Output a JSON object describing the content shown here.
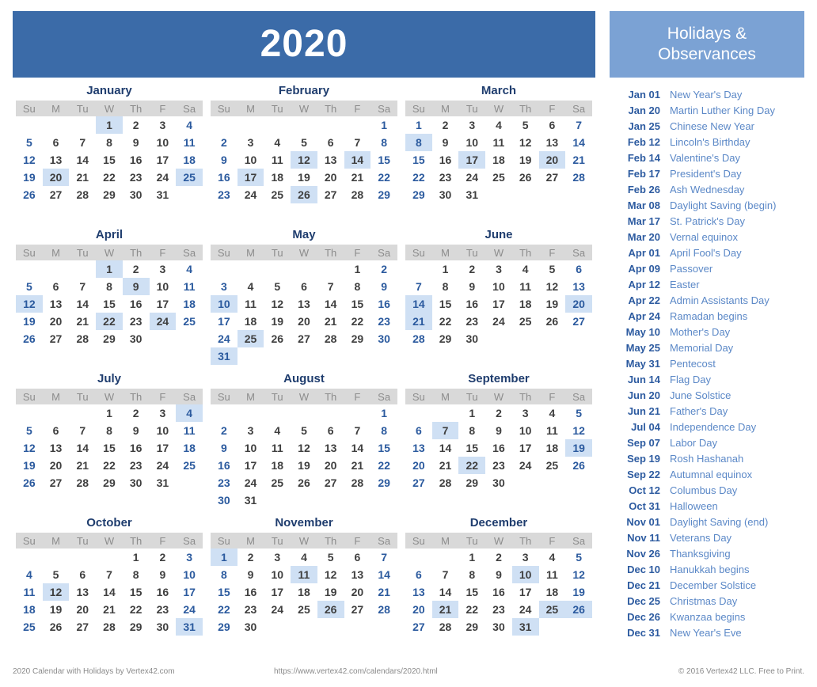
{
  "header": {
    "year": "2020"
  },
  "sidebar": {
    "title_line1": "Holidays &",
    "title_line2": "Observances"
  },
  "weekday_headers": [
    "Su",
    "M",
    "Tu",
    "W",
    "Th",
    "F",
    "Sa"
  ],
  "colors": {
    "banner_blue": "#3b6ba8",
    "sidebar_blue": "#7ba2d4",
    "highlight_blue": "#cfe0f4",
    "weekday_header_gray": "#d9d9d9",
    "weekend_text": "#2b5a9e",
    "weekday_text": "#3f3f3f",
    "month_title": "#1f3d6e",
    "holiday_date": "#2d5ba0",
    "holiday_name": "#5b88c7"
  },
  "months": [
    {
      "name": "January",
      "start": 3,
      "days": 31,
      "highlights": [
        1,
        20,
        25
      ]
    },
    {
      "name": "February",
      "start": 6,
      "days": 29,
      "highlights": [
        12,
        14,
        17,
        26
      ]
    },
    {
      "name": "March",
      "start": 0,
      "days": 31,
      "highlights": [
        8,
        17,
        20
      ]
    },
    {
      "name": "April",
      "start": 3,
      "days": 30,
      "highlights": [
        1,
        9,
        12,
        22,
        24
      ]
    },
    {
      "name": "May",
      "start": 5,
      "days": 31,
      "highlights": [
        10,
        25,
        31
      ]
    },
    {
      "name": "June",
      "start": 1,
      "days": 30,
      "highlights": [
        14,
        20,
        21
      ]
    },
    {
      "name": "July",
      "start": 3,
      "days": 31,
      "highlights": [
        4
      ]
    },
    {
      "name": "August",
      "start": 6,
      "days": 31,
      "highlights": []
    },
    {
      "name": "September",
      "start": 2,
      "days": 30,
      "highlights": [
        7,
        19,
        22
      ]
    },
    {
      "name": "October",
      "start": 4,
      "days": 31,
      "highlights": [
        12,
        31
      ]
    },
    {
      "name": "November",
      "start": 0,
      "days": 30,
      "highlights": [
        1,
        11,
        26
      ]
    },
    {
      "name": "December",
      "start": 2,
      "days": 31,
      "highlights": [
        10,
        21,
        25,
        26,
        31
      ]
    }
  ],
  "holidays": [
    {
      "date": "Jan 01",
      "name": "New Year's Day"
    },
    {
      "date": "Jan 20",
      "name": "Martin Luther King Day"
    },
    {
      "date": "Jan 25",
      "name": "Chinese New Year"
    },
    {
      "date": "Feb 12",
      "name": "Lincoln's Birthday"
    },
    {
      "date": "Feb 14",
      "name": "Valentine's Day"
    },
    {
      "date": "Feb 17",
      "name": "President's Day"
    },
    {
      "date": "Feb 26",
      "name": "Ash Wednesday"
    },
    {
      "date": "Mar 08",
      "name": "Daylight Saving (begin)"
    },
    {
      "date": "Mar 17",
      "name": "St. Patrick's Day"
    },
    {
      "date": "Mar 20",
      "name": "Vernal equinox"
    },
    {
      "date": "Apr 01",
      "name": "April Fool's Day"
    },
    {
      "date": "Apr 09",
      "name": "Passover"
    },
    {
      "date": "Apr 12",
      "name": "Easter"
    },
    {
      "date": "Apr 22",
      "name": "Admin Assistants Day"
    },
    {
      "date": "Apr 24",
      "name": "Ramadan begins"
    },
    {
      "date": "May 10",
      "name": "Mother's Day"
    },
    {
      "date": "May 25",
      "name": "Memorial Day"
    },
    {
      "date": "May 31",
      "name": "Pentecost"
    },
    {
      "date": "Jun 14",
      "name": "Flag Day"
    },
    {
      "date": "Jun 20",
      "name": "June Solstice"
    },
    {
      "date": "Jun 21",
      "name": "Father's Day"
    },
    {
      "date": "Jul 04",
      "name": "Independence Day"
    },
    {
      "date": "Sep 07",
      "name": "Labor Day"
    },
    {
      "date": "Sep 19",
      "name": "Rosh Hashanah"
    },
    {
      "date": "Sep 22",
      "name": "Autumnal equinox"
    },
    {
      "date": "Oct 12",
      "name": "Columbus Day"
    },
    {
      "date": "Oct 31",
      "name": "Halloween"
    },
    {
      "date": "Nov 01",
      "name": "Daylight Saving (end)"
    },
    {
      "date": "Nov 11",
      "name": "Veterans Day"
    },
    {
      "date": "Nov 26",
      "name": "Thanksgiving"
    },
    {
      "date": "Dec 10",
      "name": "Hanukkah begins"
    },
    {
      "date": "Dec 21",
      "name": "December Solstice"
    },
    {
      "date": "Dec 25",
      "name": "Christmas Day"
    },
    {
      "date": "Dec 26",
      "name": "Kwanzaa begins"
    },
    {
      "date": "Dec 31",
      "name": "New Year's Eve"
    }
  ],
  "footer": {
    "left": "2020 Calendar with Holidays by Vertex42.com",
    "middle": "https://www.vertex42.com/calendars/2020.html",
    "right": "© 2016 Vertex42 LLC. Free to Print."
  }
}
